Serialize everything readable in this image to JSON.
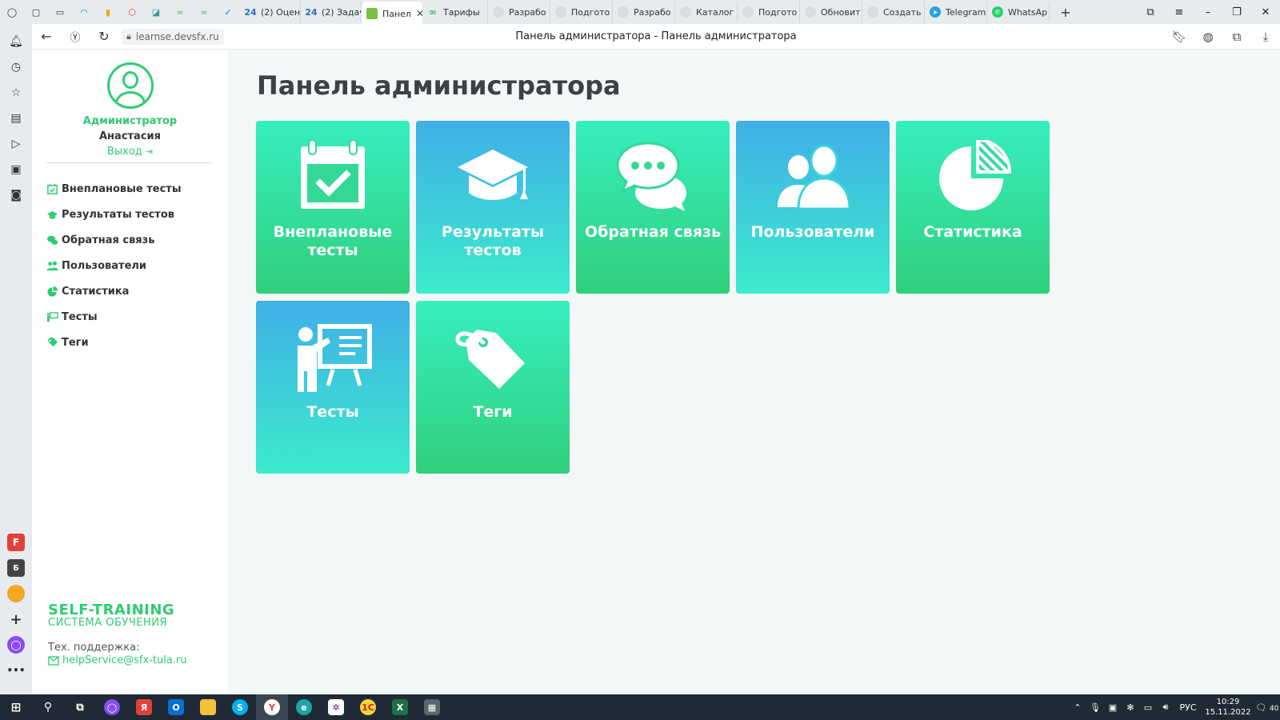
{
  "browser": {
    "tabs": [
      {
        "label": "(2) Оцен",
        "favicon_text": "24",
        "favicon_color": "#2d6bc8"
      },
      {
        "label": "(2) Задач",
        "favicon_text": "24",
        "favicon_color": "#2d6bc8"
      },
      {
        "label": "Панел",
        "favicon_text": "",
        "favicon_color": "#7ac143",
        "active": true
      },
      {
        "label": "Тарифы",
        "favicon_text": "",
        "favicon_color": "#2bc16b"
      },
      {
        "label": "Разрабо",
        "favicon_text": "",
        "favicon_color": "#dcdcdc"
      },
      {
        "label": "Подгото",
        "favicon_text": "",
        "favicon_color": "#dcdcdc"
      },
      {
        "label": "Разрабо",
        "favicon_text": "",
        "favicon_color": "#dcdcdc"
      },
      {
        "label": "Каталог",
        "favicon_text": "",
        "favicon_color": "#dcdcdc"
      },
      {
        "label": "Подгото",
        "favicon_text": "",
        "favicon_color": "#dcdcdc"
      },
      {
        "label": "Обновит",
        "favicon_text": "",
        "favicon_color": "#dcdcdc"
      },
      {
        "label": "Создать",
        "favicon_text": "",
        "favicon_color": "#dcdcdc"
      },
      {
        "label": "Telegram",
        "favicon_text": "",
        "favicon_color": "#2aa1da"
      },
      {
        "label": "WhatsAp",
        "favicon_text": "",
        "favicon_color": "#25d366"
      }
    ],
    "url": "learnse.devsfx.ru",
    "page_title": "Панель администратора - Панель администратора"
  },
  "sidebar": {
    "role": "Администратор",
    "user_name": "Анастасия",
    "logout_label": "Выход",
    "menu": [
      {
        "label": "Внеплановые тесты",
        "icon": "calendar-check-icon"
      },
      {
        "label": "Результаты тестов",
        "icon": "graduation-cap-icon"
      },
      {
        "label": "Обратная связь",
        "icon": "chat-bubbles-icon"
      },
      {
        "label": "Пользователи",
        "icon": "users-icon"
      },
      {
        "label": "Статистика",
        "icon": "pie-chart-icon"
      },
      {
        "label": "Тесты",
        "icon": "teacher-board-icon"
      },
      {
        "label": "Теги",
        "icon": "tag-icon"
      }
    ],
    "brand": "SELF-TRAINING",
    "brand_sub": "СИСТЕМА ОБУЧЕНИЯ",
    "support_label": "Тех. поддержка:",
    "support_email": "helpService@sfx-tula.ru"
  },
  "main": {
    "heading": "Панель администратора",
    "tiles": [
      {
        "label": "Внеплановые тесты",
        "icon": "calendar-check-icon",
        "style": "green"
      },
      {
        "label": "Результаты тестов",
        "icon": "graduation-cap-icon",
        "style": "blue"
      },
      {
        "label": "Обратная связь",
        "icon": "chat-bubbles-icon",
        "style": "green"
      },
      {
        "label": "Пользователи",
        "icon": "users-icon",
        "style": "blue"
      },
      {
        "label": "Статистика",
        "icon": "pie-chart-icon",
        "style": "green"
      },
      {
        "label": "Тесты",
        "icon": "teacher-board-icon",
        "style": "blue"
      },
      {
        "label": "Теги",
        "icon": "tag-icon",
        "style": "green"
      }
    ]
  },
  "taskbar": {
    "language": "РУС",
    "time": "10:29",
    "date": "15.11.2022",
    "notifications": "40"
  },
  "colors": {
    "accent": "#2ecc71",
    "tile_green": "#30d07c",
    "tile_blue": "#40afe8",
    "heading": "#3d4044",
    "page_bg": "#f2f7f7"
  }
}
